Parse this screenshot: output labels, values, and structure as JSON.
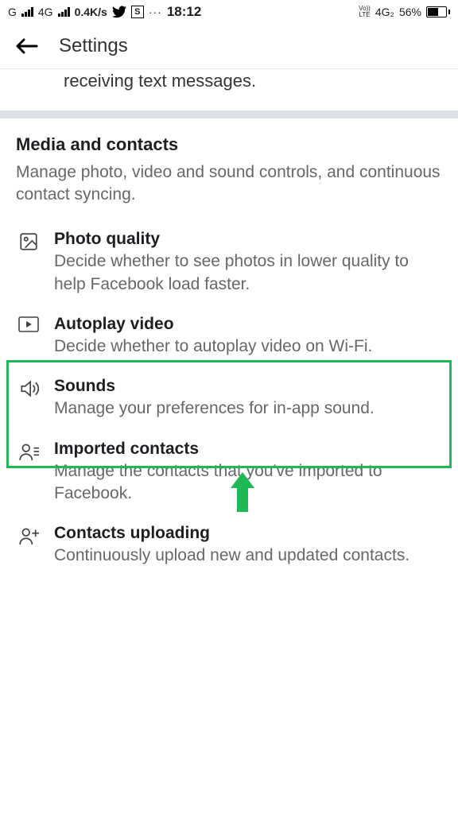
{
  "status": {
    "left_network_1_label": "G",
    "left_network_2_label": "4G",
    "data_speed": "0.4K/s",
    "time": "18:12",
    "right_volte": "Vo))\nLTE",
    "right_net": "4G₂",
    "battery_pct": "56%"
  },
  "header": {
    "title": "Settings"
  },
  "truncated": {
    "text": "receiving text messages."
  },
  "section": {
    "title": "Media and contacts",
    "subtitle": "Manage photo, video and sound controls, and continuous contact syncing.",
    "items": [
      {
        "title": "Photo quality",
        "desc": "Decide whether to see photos in lower quality to help Facebook load faster."
      },
      {
        "title": "Autoplay video",
        "desc": "Decide whether to autoplay video on Wi-Fi."
      },
      {
        "title": "Sounds",
        "desc": "Manage your preferences for in-app sound."
      },
      {
        "title": "Imported contacts",
        "desc": "Manage the contacts that you've imported to Facebook."
      },
      {
        "title": "Contacts uploading",
        "desc": "Continuously upload new and updated contacts."
      }
    ]
  }
}
